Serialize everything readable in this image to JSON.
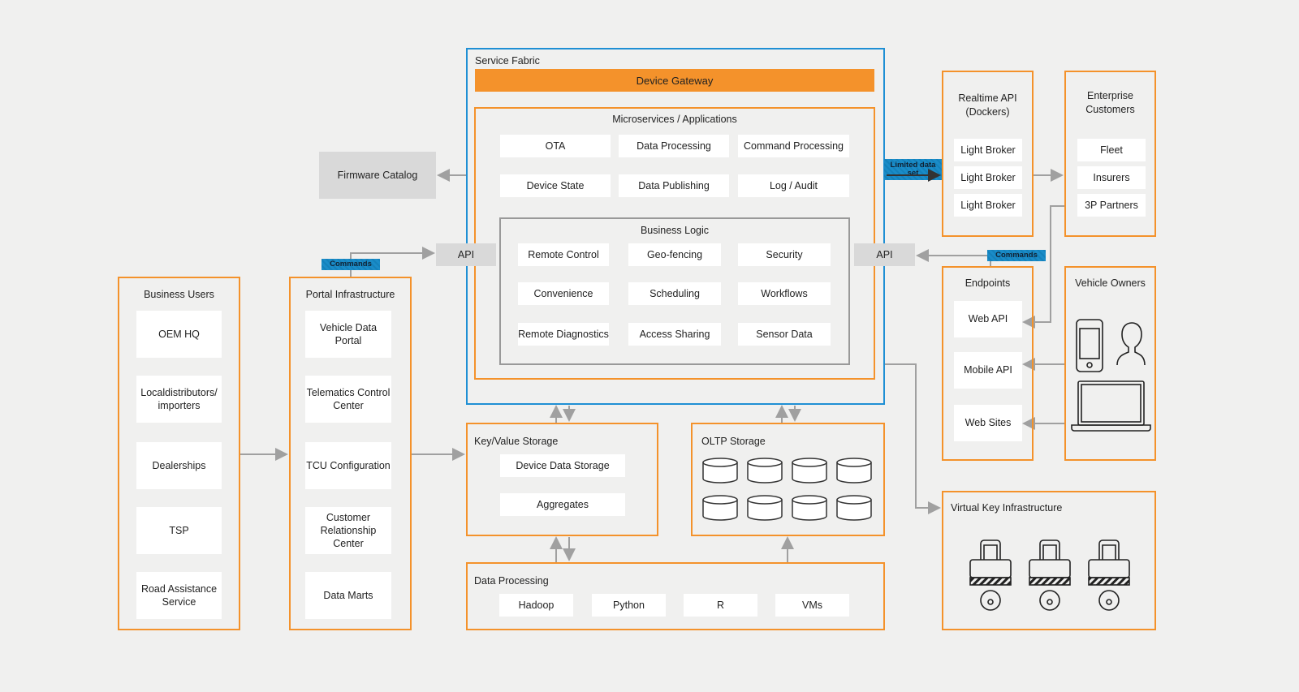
{
  "service_fabric": {
    "title": "Service Fabric",
    "device_gateway": "Device Gateway",
    "microservices": {
      "title": "Microservices / Applications",
      "items": [
        "OTA",
        "Data Processing",
        "Command Processing",
        "Device State",
        "Data Publishing",
        "Log / Audit"
      ]
    },
    "business_logic": {
      "title": "Business Logic",
      "items": [
        "Remote Control",
        "Geo-fencing",
        "Security",
        "Convenience",
        "Scheduling",
        "Workflows",
        "Remote Diagnostics",
        "Access Sharing",
        "Sensor Data"
      ]
    }
  },
  "api_left": "API",
  "api_right": "API",
  "firmware_catalog": "Firmware Catalog",
  "commands_left": "Commands",
  "commands_right": "Commands",
  "limited_data_set": "Limited data set",
  "business_users": {
    "title": "Business Users",
    "items": [
      "OEM HQ",
      "Localdistributors/ importers",
      "Dealerships",
      "TSP",
      "Road Assistance Service"
    ]
  },
  "portal_infrastructure": {
    "title": "Portal Infrastructure",
    "items": [
      "Vehicle Data Portal",
      "Telematics Control Center",
      "TCU Configuration",
      "Customer Relationship Center",
      "Data Marts"
    ]
  },
  "kv_storage": {
    "title": "Key/Value Storage",
    "items": [
      "Device Data Storage",
      "Aggregates"
    ]
  },
  "oltp_storage": {
    "title": "OLTP Storage"
  },
  "data_processing": {
    "title": "Data Processing",
    "items": [
      "Hadoop",
      "Python",
      "R",
      "VMs"
    ]
  },
  "realtime_api": {
    "title": "Realtime API (Dockers)",
    "items": [
      "Light Broker",
      "Light Broker",
      "Light Broker"
    ]
  },
  "enterprise_customers": {
    "title": "Enterprise Customers",
    "items": [
      "Fleet",
      "Insurers",
      "3P Partners"
    ]
  },
  "endpoints": {
    "title": "Endpoints",
    "items": [
      "Web API",
      "Mobile API",
      "Web Sites"
    ]
  },
  "vehicle_owners": {
    "title": "Vehicle Owners",
    "icons": [
      "smartphone-icon",
      "person-icon",
      "laptop-icon"
    ]
  },
  "virtual_key": {
    "title": "Virtual Key Infrastructure",
    "icons": [
      "padlock-key-icon",
      "padlock-key-icon",
      "padlock-key-icon"
    ]
  },
  "colors": {
    "orange": "#f4922b",
    "blue": "#1f8fd4",
    "arrow": "#a0a0a0",
    "background": "#f0f0ef"
  }
}
